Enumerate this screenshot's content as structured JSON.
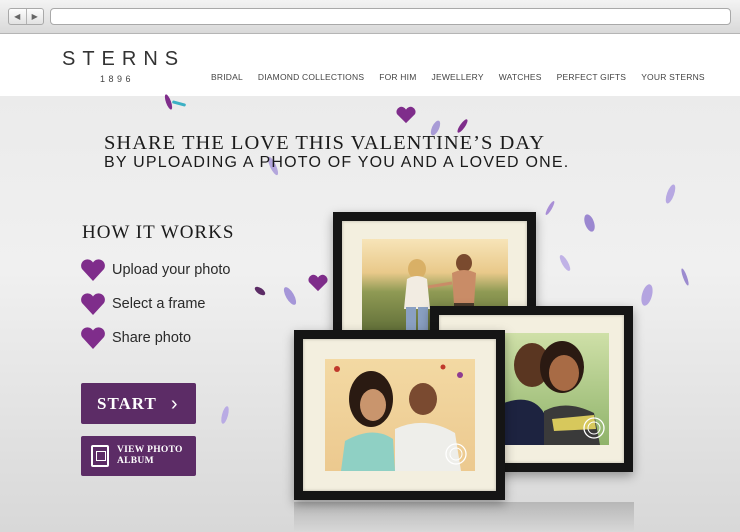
{
  "browser": {
    "back_label": "◀",
    "forward_label": "▶",
    "url": ""
  },
  "header": {
    "logo": "STERNS",
    "logo_year": "1896",
    "nav": [
      "BRIDAL",
      "DIAMOND COLLECTIONS",
      "FOR HIM",
      "JEWELLERY",
      "WATCHES",
      "PERFECT GIFTS",
      "YOUR STERNS"
    ]
  },
  "hero": {
    "headline": "SHARE THE LOVE THIS VALENTINE’S DAY",
    "subline": "BY UPLOADING A PHOTO OF YOU AND A LOVED ONE."
  },
  "how_it_works": {
    "title": "HOW IT WORKS",
    "steps": [
      "Upload your photo",
      "Select a frame",
      "Share photo"
    ]
  },
  "actions": {
    "start_label": "START",
    "album_label_line1": "VIEW PHOTO",
    "album_label_line2": "ALBUM"
  },
  "colors": {
    "brand_purple": "#5c2c66",
    "heart_purple": "#7f2d8b"
  }
}
